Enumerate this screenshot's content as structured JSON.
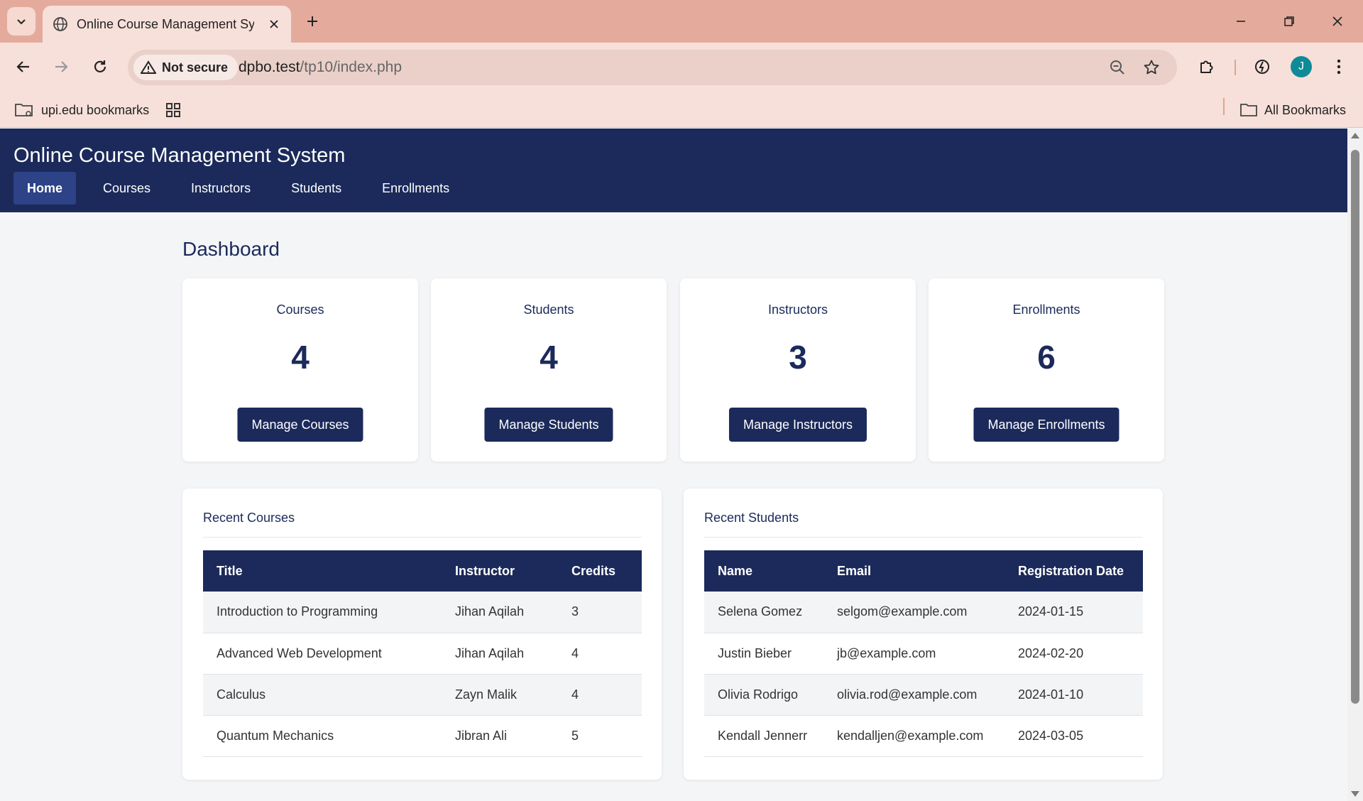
{
  "browser": {
    "tab_title": "Online Course Management System",
    "security_label": "Not secure",
    "url_host": "dpbo.test",
    "url_path": "/tp10/index.php",
    "avatar_letter": "J",
    "bookmarks": {
      "folder_label": "upi.edu bookmarks",
      "all_label": "All Bookmarks"
    }
  },
  "site": {
    "title": "Online Course Management System",
    "nav": [
      "Home",
      "Courses",
      "Instructors",
      "Students",
      "Enrollments"
    ],
    "active_nav": "Home"
  },
  "dashboard": {
    "heading": "Dashboard",
    "cards": [
      {
        "label": "Courses",
        "count": "4",
        "button": "Manage Courses"
      },
      {
        "label": "Students",
        "count": "4",
        "button": "Manage Students"
      },
      {
        "label": "Instructors",
        "count": "3",
        "button": "Manage Instructors"
      },
      {
        "label": "Enrollments",
        "count": "6",
        "button": "Manage Enrollments"
      }
    ]
  },
  "recent_courses": {
    "title": "Recent Courses",
    "columns": [
      "Title",
      "Instructor",
      "Credits"
    ],
    "rows": [
      [
        "Introduction to Programming",
        "Jihan Aqilah",
        "3"
      ],
      [
        "Advanced Web Development",
        "Jihan Aqilah",
        "4"
      ],
      [
        "Calculus",
        "Zayn Malik",
        "4"
      ],
      [
        "Quantum Mechanics",
        "Jibran Ali",
        "5"
      ]
    ]
  },
  "recent_students": {
    "title": "Recent Students",
    "columns": [
      "Name",
      "Email",
      "Registration Date"
    ],
    "rows": [
      [
        "Selena Gomez",
        "selgom@example.com",
        "2024-01-15"
      ],
      [
        "Justin Bieber",
        "jb@example.com",
        "2024-02-20"
      ],
      [
        "Olivia Rodrigo",
        "olivia.rod@example.com",
        "2024-01-10"
      ],
      [
        "Kendall Jennerr",
        "kendalljen@example.com",
        "2024-03-05"
      ]
    ]
  },
  "colors": {
    "primary": "#1b2a5a",
    "nav_active": "#2d4287",
    "page_bg": "#f4f5f7",
    "chrome_tabstrip": "#e4ab9d",
    "chrome_toolbar": "#f7e0da"
  }
}
